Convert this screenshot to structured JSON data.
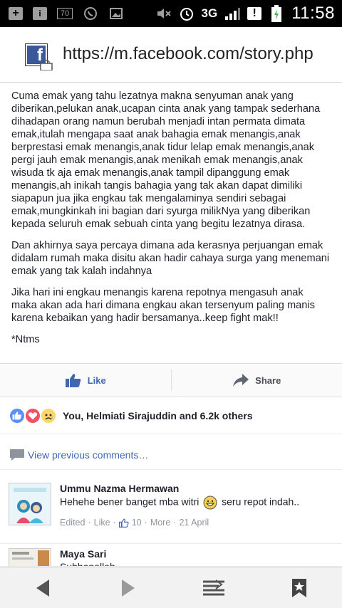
{
  "status_bar": {
    "notif_box_label": "70",
    "network": "3G",
    "alert_box_label": "!",
    "time": "11:58"
  },
  "url_bar": {
    "url": "https://m.facebook.com/story.php"
  },
  "story": {
    "paragraphs": [
      "Cuma emak yang tahu lezatnya makna senyuman anak yang diberikan,pelukan anak,ucapan cinta anak yang tampak sederhana dihadapan orang namun berubah menjadi intan permata dimata emak,itulah mengapa saat anak bahagia emak menangis,anak berprestasi emak menangis,anak tidur lelap emak menangis,anak pergi jauh emak menangis,anak menikah emak menangis,anak wisuda tk aja emak menangis,anak tampil dipanggung emak menangis,ah inikah tangis bahagia yang tak akan dapat dimiliki siapapun jua jika engkau tak mengalaminya sendiri sebagai emak,mungkinkah ini bagian dari syurga milikNya yang diberikan kepada seluruh emak sebuah cinta yang begitu lezatnya dirasa.",
      "Dan akhirnya saya percaya dimana ada kerasnya perjuangan emak didalam rumah maka disitu akan hadir cahaya surga yang menemani emak yang tak kalah indahnya",
      "Jika hari ini engkau menangis karena repotnya mengasuh anak maka akan ada hari dimana engkau akan tersenyum paling manis karena kebaikan yang hadir bersamanya..keep fight mak!!",
      "*Ntms"
    ]
  },
  "actions": {
    "like_label": "Like",
    "share_label": "Share"
  },
  "reactions": {
    "summary": "You, Helmiati Sirajuddin and 6.2k others"
  },
  "comments_section": {
    "view_previous_label": "View previous comments…"
  },
  "comments": [
    {
      "author": "Ummu Nazma Hermawan",
      "text_before_emoji": "Hehehe bener banget mba witri",
      "text_after_emoji": "seru repot indah..",
      "edited": "Edited",
      "like": "Like",
      "like_count": "10",
      "more": "More",
      "date": "21 April"
    },
    {
      "author": "Maya Sari",
      "text": "Subhanallah"
    }
  ],
  "colors": {
    "facebook_blue": "#4267b2",
    "meta_gray": "#90949c"
  }
}
